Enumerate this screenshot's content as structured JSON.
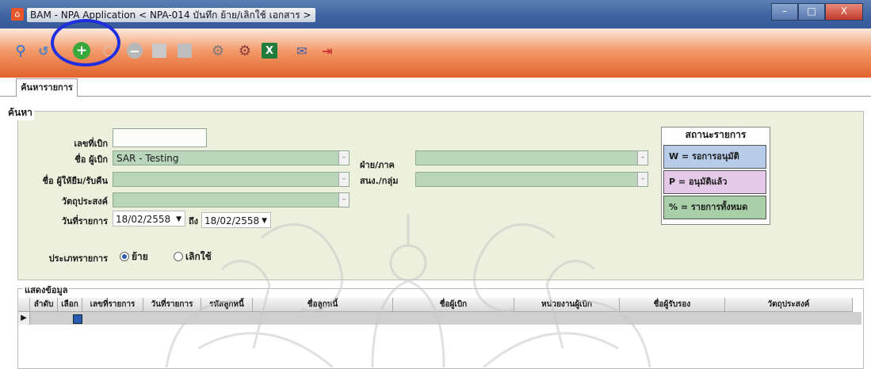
{
  "window": {
    "title": "BAM - NPA Application < NPA-014 บันทึก ย้าย/เลิกใช้ เอกสาร >",
    "minimize": "–",
    "maximize": "□",
    "close": "X"
  },
  "toolbar": {
    "icons": [
      "search-icon",
      "refresh-icon",
      "add-icon",
      "copy-icon",
      "delete-icon",
      "save-icon",
      "save-close-icon",
      "approve-icon",
      "reject-icon",
      "excel-icon",
      "mail-icon",
      "exit-icon"
    ],
    "colors": {
      "accent": "#e2632b",
      "highlight": "#1f2fe0"
    }
  },
  "tab": {
    "label": "ค้นหารายการ"
  },
  "search": {
    "group_label": "ค้นหา",
    "doc_no_label": "เลขที่เบิก",
    "doc_no_value": "",
    "requester_label": "ชื่อ ผู้เบิก",
    "requester_value": "SAR - Testing",
    "lender_label": "ชื่อ ผู้ให้ยืม/รับคืน",
    "lender_value": "",
    "purpose_label": "วัตถุประสงค์",
    "purpose_value": "",
    "date_label": "วันที่รายการ",
    "date_from": "18/02/2558",
    "date_to_label": "ถึง",
    "date_to": "18/02/2558",
    "dept_label": "ฝ่าย/ภาค",
    "dept_value": "",
    "division_label": "สนง./กลุ่ม",
    "division_value": "",
    "type_label": "ประเภทรายการ",
    "type_options": [
      "ย้าย",
      "เลิกใช้"
    ],
    "type_selected": "ย้าย"
  },
  "status": {
    "title": "สถานะรายการ",
    "items": [
      {
        "label": "W = รอการอนุมัติ",
        "color": "#b7cce8"
      },
      {
        "label": "P = อนุมัติแล้ว",
        "color": "#e5c9e8"
      },
      {
        "label": "% = รายการทั้งหมด",
        "color": "#a9cfa9"
      }
    ]
  },
  "grid": {
    "group_label": "แสดงข้อมูล",
    "columns": [
      "ลำดับ",
      "เลือก",
      "เลขที่รายการ",
      "วันที่รายการ",
      "รหัสลูกหนี้",
      "ชื่อลูกหนี้",
      "ชื่อผู้เบิก",
      "หน่วยงานผู้เบิก",
      "ชื่อผู้รับรอง",
      "วัตถุประสงค์"
    ],
    "row_indicator": "▶"
  }
}
